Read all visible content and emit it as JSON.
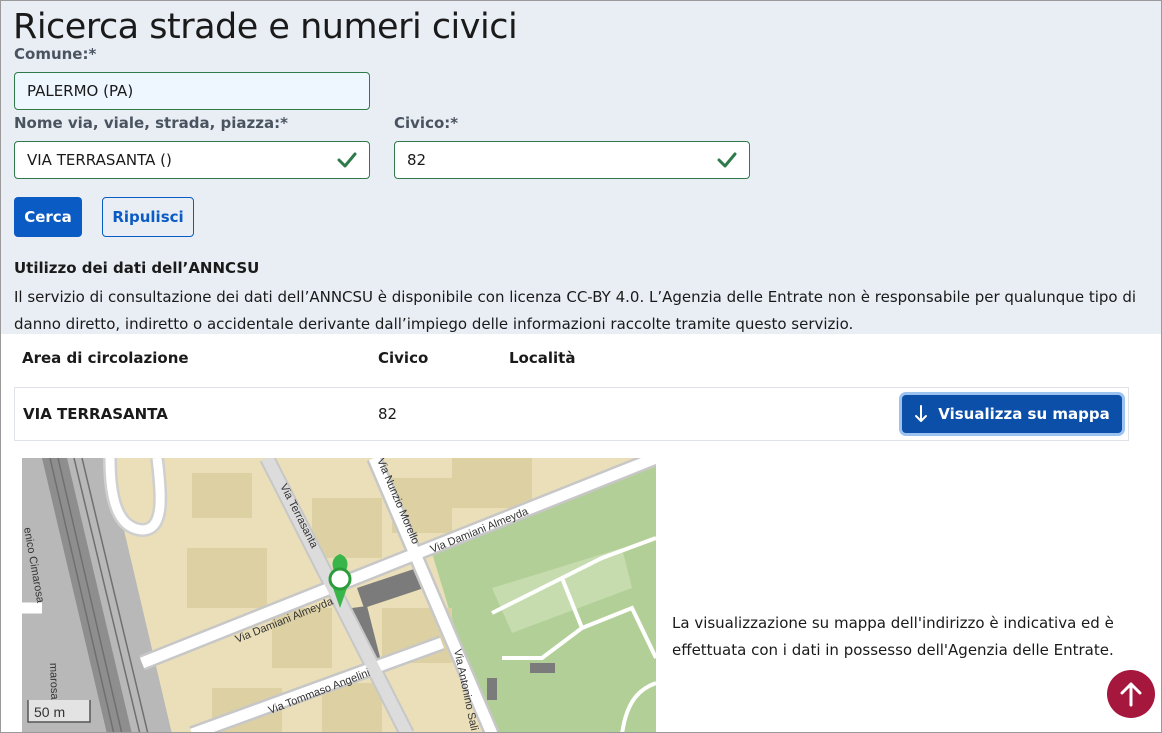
{
  "page": {
    "title": "Ricerca strade e numeri civici"
  },
  "form": {
    "comune_label": "Comune:*",
    "comune_value": "PALERMO (PA)",
    "via_label": "Nome via, viale, strada, piazza:*",
    "via_value": "VIA TERRASANTA ()",
    "civico_label": "Civico:*",
    "civico_value": "82",
    "search_label": "Cerca",
    "clear_label": "Ripulisci"
  },
  "notice": {
    "title": "Utilizzo dei dati dell’ANNCSU",
    "text": "Il servizio di consultazione dei dati dell’ANNCSU è disponibile con licenza CC-BY 4.0. L’Agenzia delle Entrate non è responsabile per qualunque tipo di danno diretto, indiretto o accidentale derivante dall’impiego delle informazioni raccolte tramite questo servizio."
  },
  "results": {
    "headers": [
      "Area di circolazione",
      "Civico",
      "Località"
    ],
    "rows": [
      {
        "area": "VIA TERRASANTA",
        "civico": "82",
        "localita": ""
      }
    ],
    "map_button_label": "Visualizza su mappa"
  },
  "map": {
    "streets": [
      "Via Terrasanta",
      "Via Nunzio Morello",
      "Via Damiani Almeyda",
      "Via Damiani Almeyda",
      "Via Tommaso Angelini",
      "Via Antonino Sali",
      "enico Cimarosa",
      "marosa"
    ],
    "scale_label": "50 m",
    "note": "La visualizzazione su mappa dell'indirizzo è indicativa ed è effettuata con i dati in possesso dell'Agenzia delle Entrate."
  },
  "colors": {
    "primary": "#0b5bc4",
    "valid_green": "#2e7a4a",
    "back_to_top": "#a5173c"
  },
  "icons": [
    "check-icon",
    "arrow-down-icon",
    "arrow-up-icon",
    "map-marker-icon"
  ]
}
